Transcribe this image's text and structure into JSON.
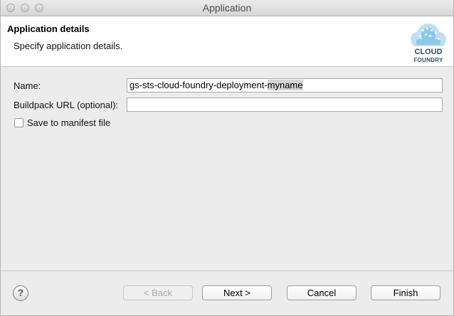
{
  "window": {
    "title": "Application"
  },
  "header": {
    "title": "Application details",
    "description": "Specify application details.",
    "logo_line1": "CLOUD",
    "logo_line2": "FOUNDRY"
  },
  "form": {
    "name_label": "Name:",
    "name_value_prefix": "gs-sts-cloud-foundry-deployment-",
    "name_value_selected": "myname",
    "buildpack_label": "Buildpack URL (optional):",
    "buildpack_value": "",
    "save_manifest_label": "Save to manifest file",
    "save_manifest_checked": false
  },
  "footer": {
    "help_icon_glyph": "?",
    "back_label": "< Back",
    "next_label": "Next >",
    "cancel_label": "Cancel",
    "finish_label": "Finish"
  }
}
